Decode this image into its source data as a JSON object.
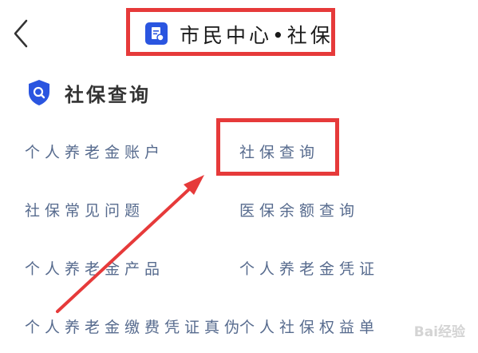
{
  "header": {
    "title": "市民中心•社保"
  },
  "section": {
    "title": "社保查询"
  },
  "links": [
    "个人养老金账户",
    "社保查询",
    "社保常见问题",
    "医保余额查询",
    "个人养老金产品",
    "个人养老金凭证",
    "个人养老金缴费凭证真伪",
    "个人社保权益单"
  ],
  "watermark": "Bai经验",
  "colors": {
    "accent": "#2a55e0",
    "highlight": "#e63a3a",
    "link": "#576b8e"
  }
}
